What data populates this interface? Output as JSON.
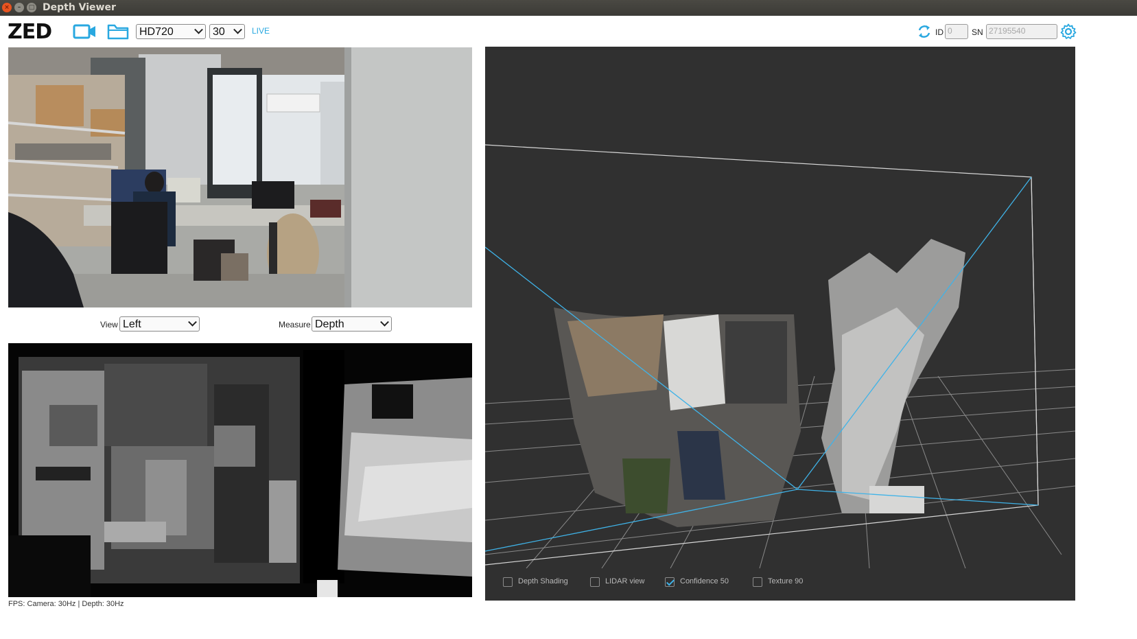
{
  "window": {
    "title": "Depth Viewer"
  },
  "toolbar": {
    "logo": "ZED",
    "resolution": {
      "selected": "HD720"
    },
    "fps": {
      "selected": "30"
    },
    "status": "LIVE",
    "id_label": "ID",
    "id_value": "0",
    "sn_label": "SN",
    "sn_value": "27195540"
  },
  "left_panel": {
    "view_label": "View",
    "view_selected": "Left",
    "measure_label": "Measure",
    "measure_selected": "Depth",
    "fps_text": "FPS: Camera: 30Hz | Depth: 30Hz"
  },
  "point_cloud": {
    "options": [
      {
        "label": "Depth Shading",
        "checked": false
      },
      {
        "label": "LIDAR view",
        "checked": false
      },
      {
        "label": "Confidence 50",
        "checked": true
      },
      {
        "label": "Texture 90",
        "checked": false
      }
    ]
  },
  "colors": {
    "accent": "#29a8e0",
    "titlebar": "#3c3b37",
    "viewer_bg": "#303030",
    "frustum": "#3fb3e8"
  },
  "icons": {
    "camera": "video-camera-icon",
    "folder": "folder-icon",
    "refresh": "refresh-icon",
    "settings": "gear-icon"
  }
}
